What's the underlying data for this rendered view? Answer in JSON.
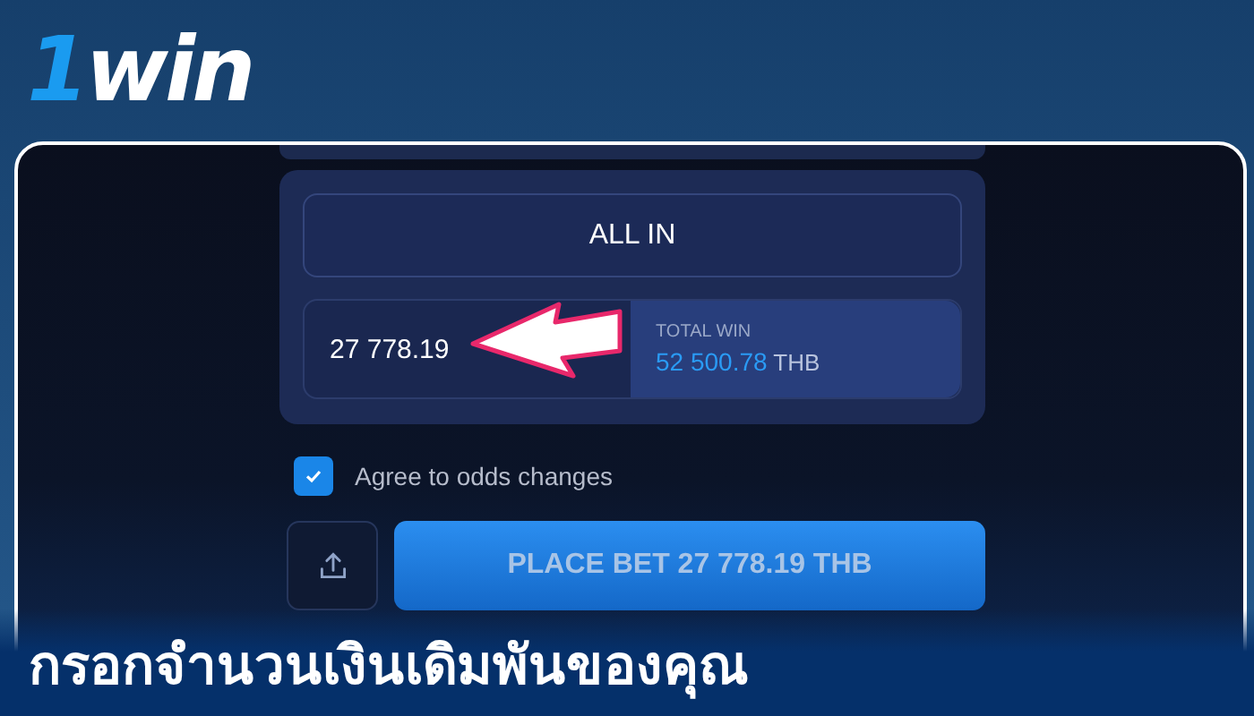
{
  "logo": {
    "digit": "1",
    "word": "win"
  },
  "bet_panel": {
    "all_in_button": "ALL IN",
    "stake_value": "27 778.19",
    "total_win": {
      "label": "TOTAL WIN",
      "amount": "52 500.78",
      "currency": "THB"
    }
  },
  "agree_checkbox": {
    "label": "Agree to odds changes",
    "checked": true
  },
  "place_bet_button": "PLACE BET 27 778.19 THB",
  "caption": "กรอกจำนวนเงินเดิมพันของคุณ"
}
